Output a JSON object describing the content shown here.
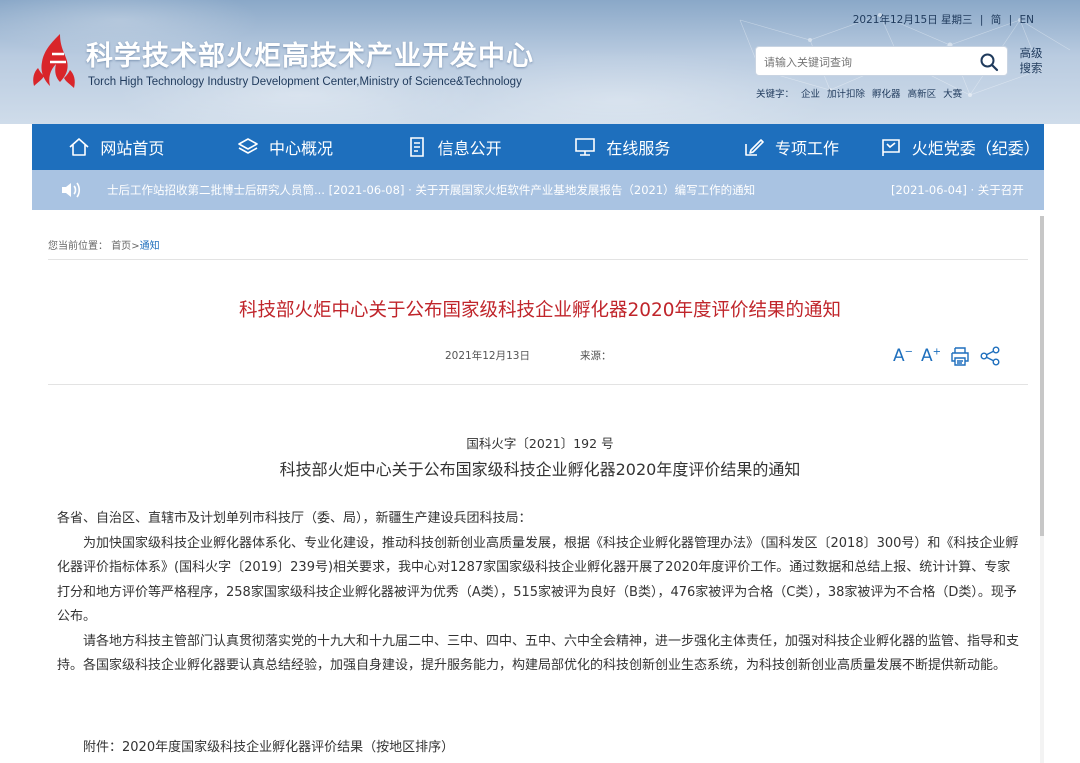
{
  "topbar": {
    "date": "2021年12月15日 星期三",
    "lang_cn": "简",
    "lang_en": "EN",
    "sep": "|"
  },
  "site": {
    "title": "科学技术部火炬高技术产业开发中心",
    "subtitle": "Torch High Technology Industry Development Center,Ministry of Science&Technology"
  },
  "search": {
    "placeholder": "请输入关键词查询",
    "advanced": "高级搜索"
  },
  "keywords": {
    "label": "关键字：",
    "items": [
      "企业",
      "加计扣除",
      "孵化器",
      "高新区",
      "大赛"
    ]
  },
  "nav": [
    {
      "label": "网站首页",
      "icon": "home-icon"
    },
    {
      "label": "中心概况",
      "icon": "layers-icon"
    },
    {
      "label": "信息公开",
      "icon": "document-icon"
    },
    {
      "label": "在线服务",
      "icon": "monitor-icon"
    },
    {
      "label": "专项工作",
      "icon": "edit-icon"
    },
    {
      "label": "火炬党委（纪委）",
      "icon": "flag-icon"
    }
  ],
  "ticker": {
    "item1": "士后工作站招收第二批博士后研究人员筒...  [2021-06-08] · 关于开展国家火炬软件产业基地发展报告（2021）编写工作的通知",
    "item2": "[2021-06-04] · 关于召开"
  },
  "breadcrumb": {
    "prefix": "您当前位置：",
    "home": "首页",
    "sep": ">",
    "current": "通知"
  },
  "article": {
    "title": "科技部火炬中心关于公布国家级科技企业孵化器2020年度评价结果的通知",
    "date": "2021年12月13日",
    "source_label": "来源：",
    "font_large": "A",
    "font_small": "A",
    "doc_number": "国科火字〔2021〕192 号",
    "subtitle": "科技部火炬中心关于公布国家级科技企业孵化器2020年度评价结果的通知",
    "salutation": "各省、自治区、直辖市及计划单列市科技厅（委、局），新疆生产建设兵团科技局：",
    "para1": "为加快国家级科技企业孵化器体系化、专业化建设，推动科技创新创业高质量发展，根据《科技企业孵化器管理办法》（国科发区〔2018〕300号）和《科技企业孵化器评价指标体系》(国科火字〔2019〕239号)相关要求，我中心对1287家国家级科技企业孵化器开展了2020年度评价工作。通过数据和总结上报、统计计算、专家打分和地方评价等严格程序，258家国家级科技企业孵化器被评为优秀（A类），515家被评为良好（B类），476家被评为合格（C类），38家被评为不合格（D类）。现予公布。",
    "para2": "请各地方科技主管部门认真贯彻落实党的十九大和十九届二中、三中、四中、五中、六中全会精神，进一步强化主体责任，加强对科技企业孵化器的监管、指导和支持。各国家级科技企业孵化器要认真总结经验，加强自身建设，提升服务能力，构建局部优化的科技创新创业生态系统，为科技创新创业高质量发展不断提供新动能。",
    "attachment": "附件：2020年度国家级科技企业孵化器评价结果（按地区排序）"
  },
  "colors": {
    "nav": "#1e6fbd",
    "ticker": "#a9c3e2",
    "title_red": "#c0252b",
    "logo_red": "#d9252a"
  }
}
